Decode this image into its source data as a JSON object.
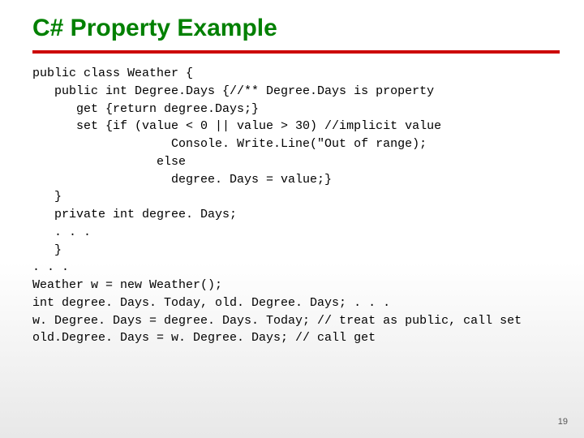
{
  "title": "C# Property Example",
  "code": {
    "l1": "public class Weather {",
    "l2": "   public int Degree.Days {//** Degree.Days is property",
    "l3": "      get {return degree.Days;}",
    "l4": "      set {if (value < 0 || value > 30) //implicit value",
    "l5": "                   Console. Write.Line(\"Out of range);",
    "l6": "                 else",
    "l7": "                   degree. Days = value;}",
    "l8": "   }",
    "l9": "   private int degree. Days;",
    "l10": "   . . .",
    "l11": "   }",
    "l12": ". . .",
    "l13": "Weather w = new Weather();",
    "l14": "int degree. Days. Today, old. Degree. Days; . . .",
    "l15": "w. Degree. Days = degree. Days. Today; // treat as public, call set",
    "l16": "old.Degree. Days = w. Degree. Days; // call get"
  },
  "page_number": "19"
}
